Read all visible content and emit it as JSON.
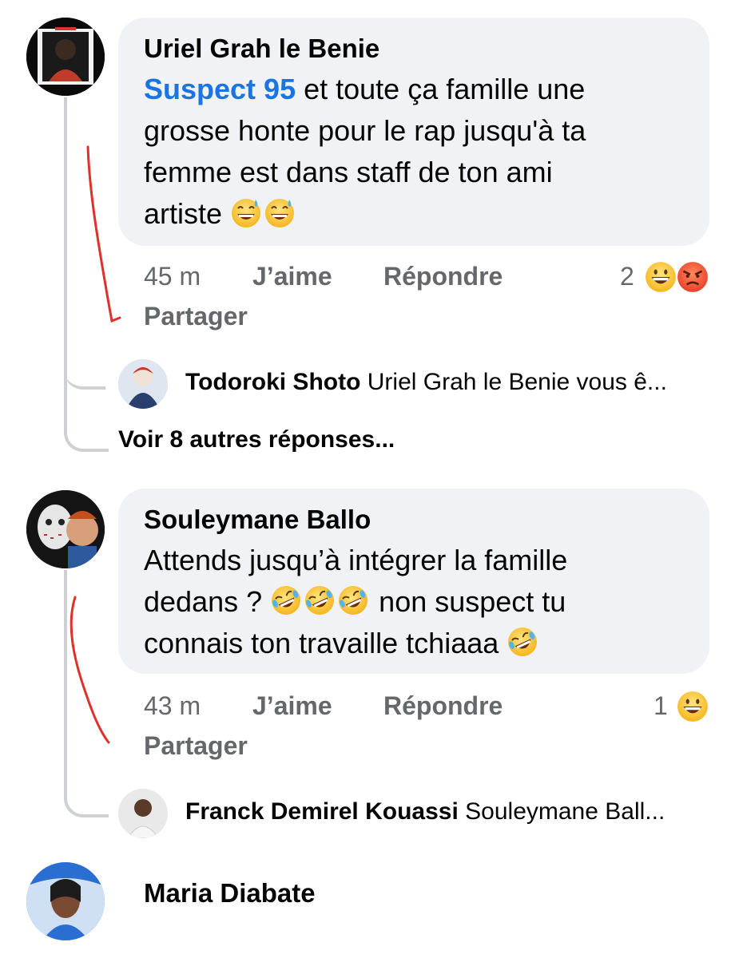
{
  "comments": [
    {
      "author": "Uriel Grah le Benie",
      "mention": "Suspect 95",
      "text_line1": "et toute ça famille une",
      "text_line2": "grosse honte pour le rap jusqu'à ta",
      "text_line3": "femme est dans staff de ton ami",
      "text_line4": "artiste",
      "time": "45 m",
      "like": "J’aime",
      "reply": "Répondre",
      "share": "Partager",
      "reaction_count": "2",
      "reply_preview": {
        "name": "Todoroki Shoto",
        "text": "Uriel Grah le Benie vous ê..."
      },
      "more_replies": "Voir 8 autres réponses..."
    },
    {
      "author": "Souleymane Ballo",
      "text_line1": "Attends jusqu’à intégrer la famille",
      "text_line2a": "dedans ?",
      "text_line2b": "non suspect tu",
      "text_line3": "connais ton travaille tchiaaa",
      "time": "43 m",
      "like": "J’aime",
      "reply": "Répondre",
      "share": "Partager",
      "reaction_count": "1",
      "reply_preview": {
        "name": "Franck Demirel Kouassi",
        "text": "Souleymane Ball..."
      }
    },
    {
      "author": "Maria Diabate"
    }
  ],
  "colors": {
    "bubble": "#f0f2f5",
    "mention": "#1b74e4",
    "meta": "#65676b",
    "annotation": "#e0302a"
  },
  "icons": [
    "sweat-smile-emoji",
    "laughing-emoji",
    "angry-emoji",
    "rofl-emoji"
  ]
}
